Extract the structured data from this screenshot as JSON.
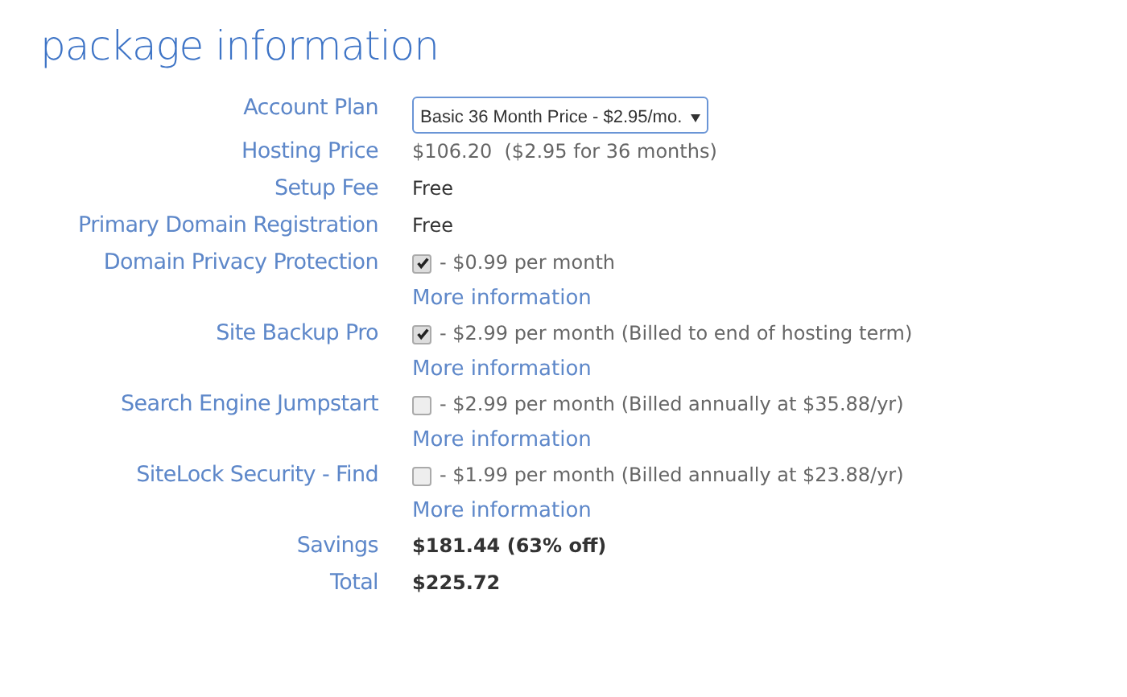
{
  "heading": "package information",
  "rows": [
    {
      "label": "Account Plan",
      "kind": "select",
      "value": "Basic 36 Month Price - $2.95/mo."
    },
    {
      "label": "Hosting Price",
      "kind": "muted",
      "value": "$106.20  ($2.95 for 36 months)"
    },
    {
      "label": "Setup Fee",
      "kind": "plain",
      "value": "Free"
    },
    {
      "label": "Primary Domain Registration",
      "kind": "plain",
      "value": "Free"
    },
    {
      "label": "Domain Privacy Protection",
      "kind": "addon",
      "checked": true,
      "value": "- $0.99 per month",
      "link": "More information"
    },
    {
      "label": "Site Backup Pro",
      "kind": "addon",
      "checked": true,
      "value": "- $2.99 per month (Billed to end of hosting term)",
      "link": "More information"
    },
    {
      "label": "Search Engine Jumpstart",
      "kind": "addon",
      "checked": false,
      "value": "- $2.99 per month (Billed annually at $35.88/yr)",
      "link": "More information"
    },
    {
      "label": "SiteLock Security - Find",
      "kind": "addon",
      "checked": false,
      "value": "- $1.99 per month (Billed annually at $23.88/yr)",
      "link": "More information"
    },
    {
      "label": "Savings",
      "kind": "strong",
      "value": "$181.44 (63% off)"
    },
    {
      "label": "Total",
      "kind": "strong",
      "value": "$225.72"
    }
  ]
}
